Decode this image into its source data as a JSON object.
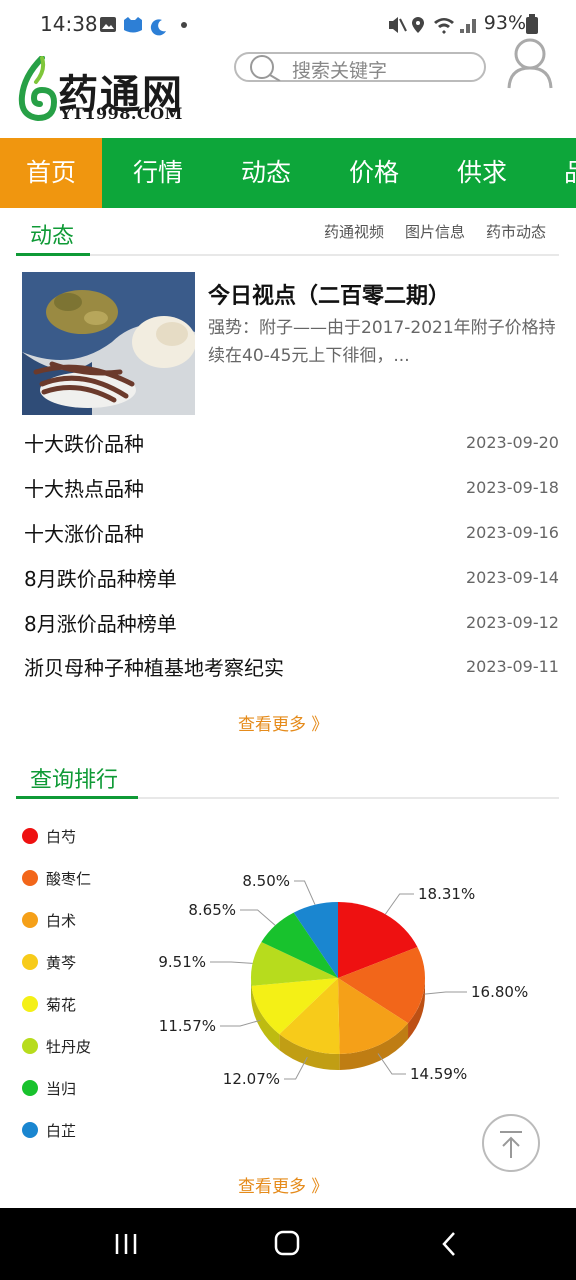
{
  "status_bar": {
    "time": "14:38",
    "battery": "93%",
    "icons": [
      "gallery-icon",
      "cat-app-icon",
      "wave-app-icon",
      "dot-icon",
      "mute-icon",
      "location-icon",
      "wifi-icon",
      "signal-icon",
      "battery-icon"
    ]
  },
  "header": {
    "logo_text": "药通网",
    "logo_domain": "YT1998.COM",
    "search_placeholder": "搜索关键字"
  },
  "nav": {
    "items": [
      "首页",
      "行情",
      "动态",
      "价格",
      "供求",
      "品"
    ],
    "active_index": 0
  },
  "news_section": {
    "title": "动态",
    "subtabs": [
      "药通视频",
      "图片信息",
      "药市动态"
    ],
    "featured": {
      "title": "今日视点（二百零二期）",
      "summary": "强势：附子——由于2017-2021年附子价格持续在40-45元上下徘徊，..."
    },
    "items": [
      {
        "title": "十大跌价品种",
        "date": "2023-09-20"
      },
      {
        "title": "十大热点品种",
        "date": "2023-09-18"
      },
      {
        "title": "十大涨价品种",
        "date": "2023-09-16"
      },
      {
        "title": "8月跌价品种榜单",
        "date": "2023-09-14"
      },
      {
        "title": "8月涨价品种榜单",
        "date": "2023-09-12"
      },
      {
        "title": "浙贝母种子种植基地考察纪实",
        "date": "2023-09-11"
      }
    ],
    "more": "查看更多 》"
  },
  "ranking_section": {
    "title": "查询排行",
    "more": "查看更多 》"
  },
  "chart_data": {
    "type": "pie",
    "style": "3d",
    "legend_position": "left",
    "categories": [
      "白芍",
      "酸枣仁",
      "白术",
      "黄芩",
      "菊花",
      "牡丹皮",
      "当归",
      "白芷"
    ],
    "values": [
      18.31,
      16.8,
      14.59,
      12.07,
      11.57,
      9.51,
      8.65,
      8.5
    ],
    "labels": [
      "18.31%",
      "16.80%",
      "14.59%",
      "12.07%",
      "11.57%",
      "9.51%",
      "8.65%",
      "8.50%"
    ],
    "colors": [
      "#ee1111",
      "#f2661a",
      "#f5a018",
      "#f7cb1a",
      "#f4f016",
      "#b7dc1d",
      "#18c22d",
      "#1a86d0"
    ]
  },
  "footer": {
    "icons": [
      "recent-apps-icon",
      "home-icon",
      "back-icon"
    ]
  }
}
